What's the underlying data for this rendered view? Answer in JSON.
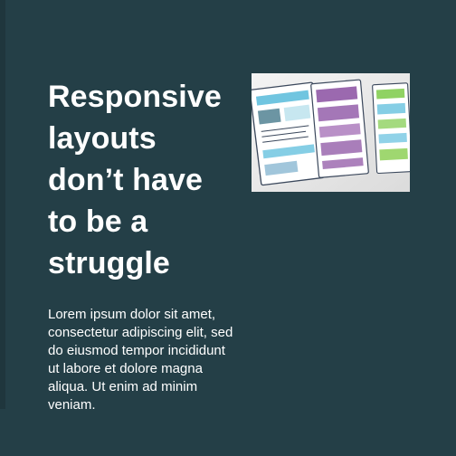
{
  "article": {
    "headline_lines": [
      "Responsive",
      "layouts",
      "don’t have",
      "to be a",
      "struggle"
    ],
    "body": "Lorem ipsum dolor sit amet, consectetur adipiscing elit, sed do eiusmod tempor incididunt ut labore et dolore magna aliqua. Ut enim ad minim veniam."
  },
  "image": {
    "icon": "wireframe-sketch-photo-icon"
  },
  "colors": {
    "background": "#243f47",
    "text": "#ffffff",
    "sketch_blue": "#53b9db",
    "sketch_purple": "#8a4fa2",
    "sketch_green": "#7ac943"
  }
}
